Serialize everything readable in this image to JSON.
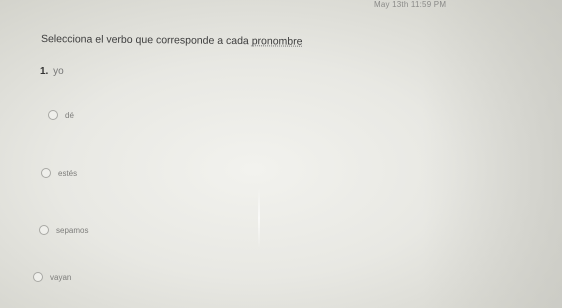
{
  "status_bar": {
    "timestamp": "May 13th 11:59 PM"
  },
  "quiz": {
    "instruction": {
      "prefix": "Selecciona el verbo que corresponde a cada ",
      "emphasis": "pronombre"
    },
    "question": {
      "number": "1.",
      "pronoun": "yo",
      "options": [
        {
          "label": "dé"
        },
        {
          "label": "estés"
        },
        {
          "label": "sepamos"
        },
        {
          "label": "vayan"
        }
      ]
    }
  }
}
